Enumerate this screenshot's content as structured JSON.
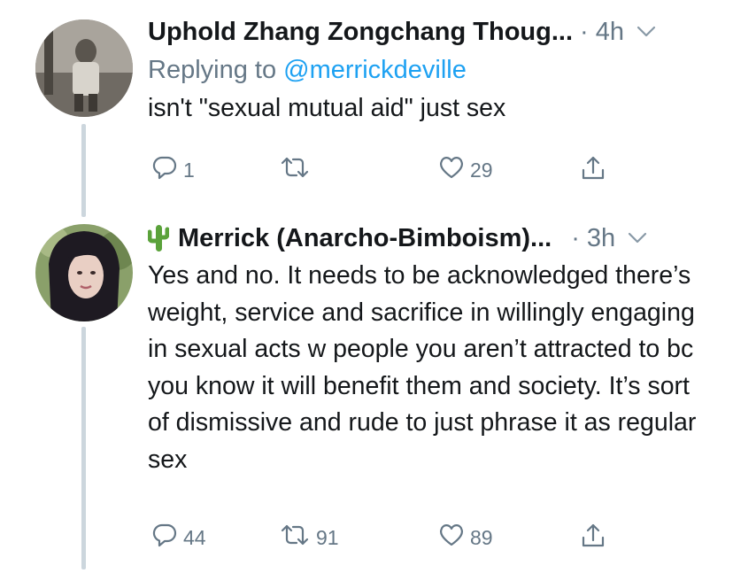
{
  "tweets": [
    {
      "author": "Uphold Zhang Zongchang Thoug...",
      "time_meta": "· 4h",
      "replying_prefix": "Replying to",
      "replying_to": "@merrickdeville",
      "text": "isn't \"sexual mutual aid\" just sex",
      "replies": "1",
      "retweets": "",
      "likes": "29"
    },
    {
      "author_emoji": "cactus-icon",
      "author": "Merrick (Anarcho-Bimboism)...",
      "time_meta": "· 3h",
      "text": "Yes and no. It needs to be acknowledged there’s weight, service and sacrifice in willingly engaging in sexual acts w people you aren’t attracted to bc you know it will benefit them and society. It’s sort of dismissive and rude to just phrase it as regular sex",
      "replies": "44",
      "retweets": "91",
      "likes": "89"
    }
  ],
  "colors": {
    "text": "#14171a",
    "secondary": "#657786",
    "link": "#1da1f2",
    "thread_line": "#ccd6dd"
  }
}
